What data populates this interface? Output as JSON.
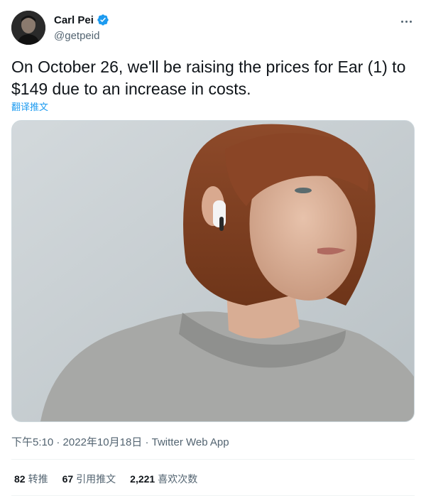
{
  "author": {
    "display_name": "Carl Pei",
    "handle": "@getpeid",
    "verified": true
  },
  "tweet": {
    "text": "On October 26, we'll be raising the prices for Ear (1) to\n$149 due to an increase in costs.",
    "translate_label": "翻译推文"
  },
  "meta": {
    "time": "下午5:10",
    "separator": "·",
    "date": "2022年10月18日",
    "source": "Twitter Web App"
  },
  "stats": [
    {
      "count": "82",
      "label": "转推"
    },
    {
      "count": "67",
      "label": "引用推文"
    },
    {
      "count": "2,221",
      "label": "喜欢次数"
    }
  ],
  "icons": {
    "verified": "verified-badge-icon",
    "more": "more-options-icon"
  },
  "colors": {
    "accent": "#1d9bf0",
    "secondary_text": "#536471",
    "primary_text": "#0f1419"
  }
}
